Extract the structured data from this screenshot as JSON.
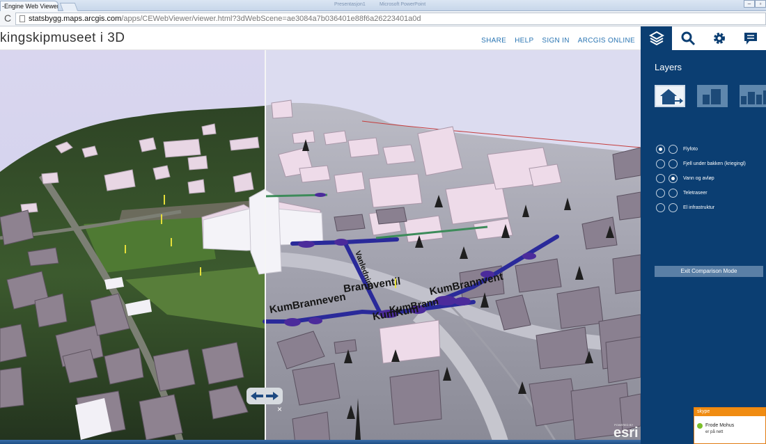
{
  "browser": {
    "tab_title": "-Engine Web Viewer - \\",
    "taskbar_hint_1": "Presentasjon1",
    "taskbar_hint_2": "Microsoft PowerPoint",
    "url_host": "statsbygg.maps.arcgis.com",
    "url_path": "/apps/CEWebViewer/viewer.html?3dWebScene=ae3084a7b036401e88f6a26223401a0d",
    "reload_icon": "reload-icon"
  },
  "app": {
    "title": "kingskipmuseet i 3D",
    "links": [
      "SHARE",
      "HELP",
      "SIGN IN",
      "ARCGIS ONLINE"
    ]
  },
  "panel": {
    "tabs": [
      "layers-icon",
      "search-icon",
      "gear-icon",
      "comment-icon"
    ],
    "active_tab": "layers-icon",
    "heading": "Layers",
    "thumbnails": [
      "compare-layers-icon",
      "building-layer-icon",
      "city-layer-icon"
    ],
    "layers": [
      {
        "label": "Flyfoto",
        "left_on": true,
        "right_on": false
      },
      {
        "label": "Fjell under bakken (kriegingl)",
        "left_on": false,
        "right_on": false
      },
      {
        "label": "Vann og avløp",
        "left_on": false,
        "right_on": true
      },
      {
        "label": "Teletraseer",
        "left_on": false,
        "right_on": false
      },
      {
        "label": "El infrastruktur",
        "left_on": false,
        "right_on": false
      }
    ],
    "exit_button": "Exit Comparison Mode",
    "accent": "#0b3e72"
  },
  "scene": {
    "street_labels": [
      "Brannventil",
      "KumBrannvent",
      "KumBranneven",
      "KumKum",
      "Vanledning",
      "KumBrann"
    ],
    "esri_powered": "POWERED BY",
    "esri_logo": "esri",
    "swipe_close": "×"
  },
  "skype": {
    "title": "skype",
    "name": "Frode Mohus",
    "status": "er på nett"
  }
}
